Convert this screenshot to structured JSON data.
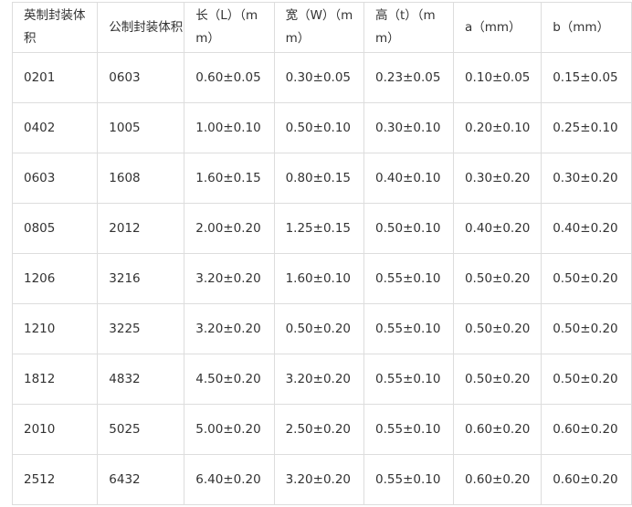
{
  "table": {
    "headers": [
      "英制封装体积",
      "公制封装体积",
      "长（L）（mm）",
      "宽（W）（mm）",
      "高（t）（mm）",
      "a（mm）",
      "b（mm）"
    ],
    "rows": [
      [
        "0201",
        "0603",
        "0.60±0.05",
        "0.30±0.05",
        "0.23±0.05",
        "0.10±0.05",
        "0.15±0.05"
      ],
      [
        "0402",
        "1005",
        "1.00±0.10",
        "0.50±0.10",
        "0.30±0.10",
        "0.20±0.10",
        "0.25±0.10"
      ],
      [
        "0603",
        "1608",
        "1.60±0.15",
        "0.80±0.15",
        "0.40±0.10",
        "0.30±0.20",
        "0.30±0.20"
      ],
      [
        "0805",
        "2012",
        "2.00±0.20",
        "1.25±0.15",
        "0.50±0.10",
        "0.40±0.20",
        "0.40±0.20"
      ],
      [
        "1206",
        "3216",
        "3.20±0.20",
        "1.60±0.10",
        "0.55±0.10",
        "0.50±0.20",
        "0.50±0.20"
      ],
      [
        "1210",
        "3225",
        "3.20±0.20",
        "0.50±0.20",
        "0.55±0.10",
        "0.50±0.20",
        "0.50±0.20"
      ],
      [
        "1812",
        "4832",
        "4.50±0.20",
        "3.20±0.20",
        "0.55±0.10",
        "0.50±0.20",
        "0.50±0.20"
      ],
      [
        "2010",
        "5025",
        "5.00±0.20",
        "2.50±0.20",
        "0.55±0.10",
        "0.60±0.20",
        "0.60±0.20"
      ],
      [
        "2512",
        "6432",
        "6.40±0.20",
        "3.20±0.20",
        "0.55±0.10",
        "0.60±0.20",
        "0.60±0.20"
      ]
    ]
  }
}
